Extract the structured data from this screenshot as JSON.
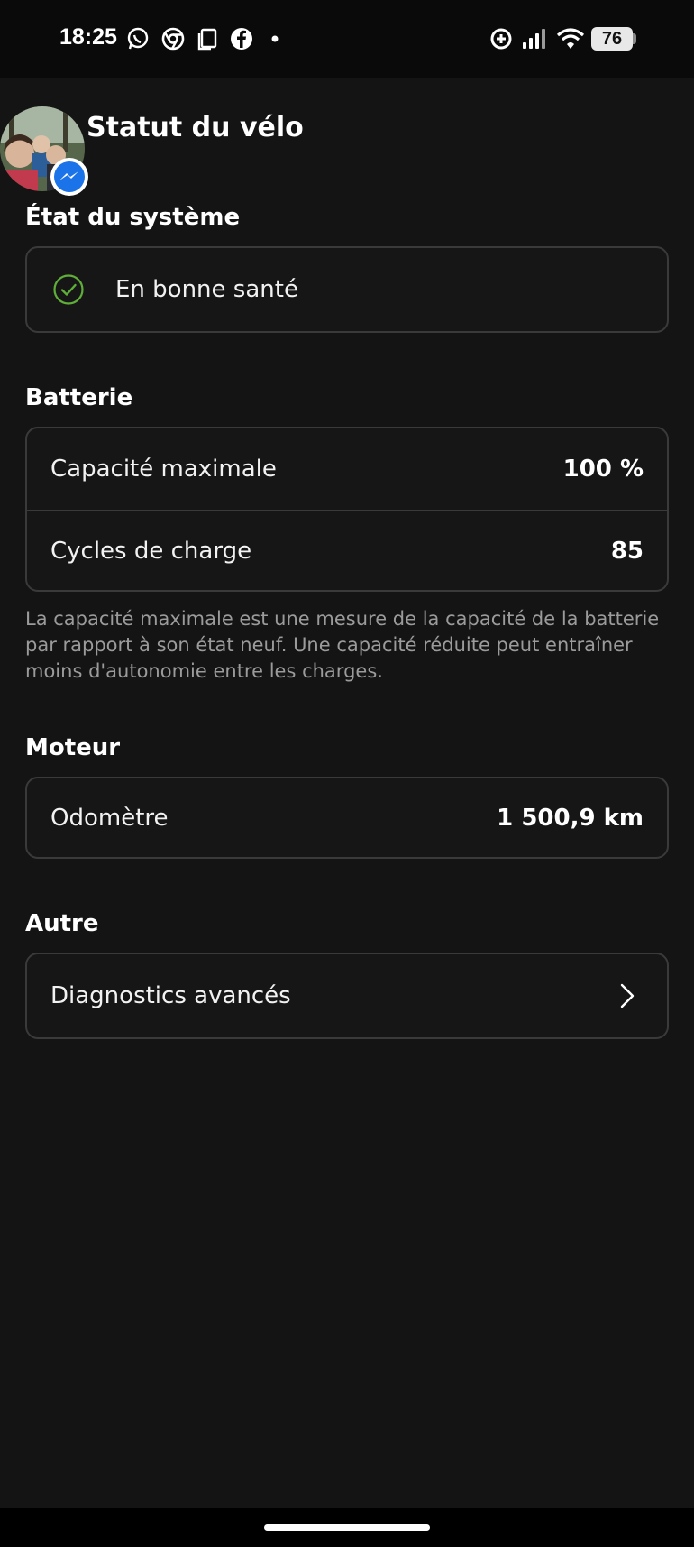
{
  "status_bar": {
    "time": "18:25",
    "notification_icons": [
      "whatsapp-icon",
      "chrome-icon",
      "copy-icon",
      "facebook-icon",
      "dot-icon"
    ],
    "system_icons": [
      "data-saver-icon",
      "signal-icon",
      "wifi-icon"
    ],
    "battery": "76"
  },
  "header": {
    "title": "Statut du vélo",
    "badge_icon": "messenger-icon"
  },
  "system_state": {
    "title": "État du système",
    "status_label": "En bonne santé",
    "status_icon": "check-circle-icon",
    "status_color": "#5fae3a"
  },
  "battery_section": {
    "title": "Batterie",
    "rows": [
      {
        "label": "Capacité maximale",
        "value": "100 %"
      },
      {
        "label": "Cycles de charge",
        "value": "85"
      }
    ],
    "note": "La capacité maximale est une mesure de la capacité de la batterie par rapport à son état neuf. Une capacité réduite peut entraîner moins d'autonomie entre les charges."
  },
  "motor_section": {
    "title": "Moteur",
    "rows": [
      {
        "label": "Odomètre",
        "value": "1 500,9 km"
      }
    ]
  },
  "other_section": {
    "title": "Autre",
    "rows": [
      {
        "label": "Diagnostics avancés",
        "icon": "chevron-right-icon"
      }
    ]
  }
}
